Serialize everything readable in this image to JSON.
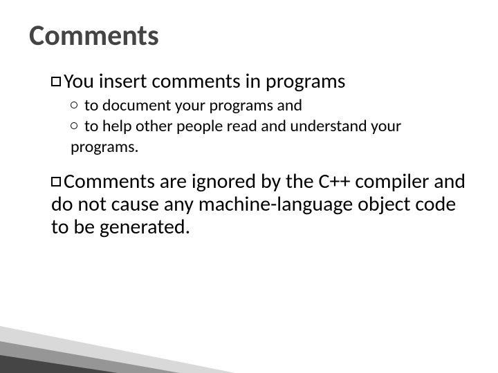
{
  "slide": {
    "title": "Comments",
    "bullets": [
      {
        "text": "You insert comments in programs",
        "sub": [
          "to document your programs and",
          "to help other people read and understand your programs."
        ]
      },
      {
        "text": "Comments are ignored by the C++ compiler and do not cause any machine-language object code to be generated.",
        "sub": []
      }
    ]
  }
}
